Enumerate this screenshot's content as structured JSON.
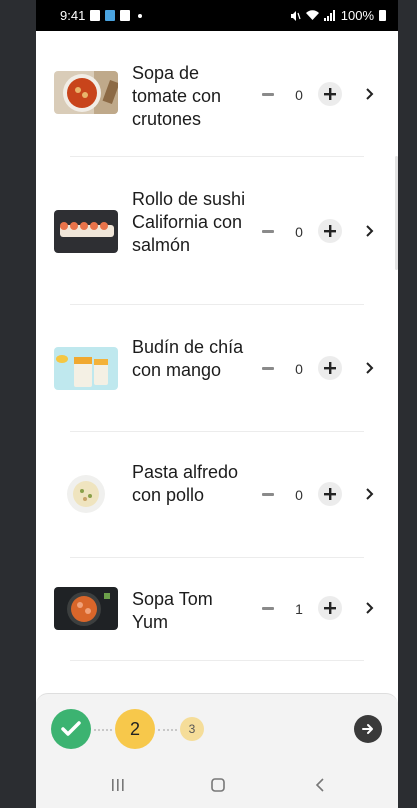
{
  "status_bar": {
    "time": "9:41",
    "battery": "100%"
  },
  "items": [
    {
      "name": "Sopa de tomate con crutones",
      "qty": "0"
    },
    {
      "name": "Rollo de sushi California con salmón",
      "qty": "0"
    },
    {
      "name": "Budín de chía con mango",
      "qty": "0"
    },
    {
      "name": "Pasta alfredo con pollo",
      "qty": "0"
    },
    {
      "name": "Sopa Tom Yum",
      "qty": "1"
    }
  ],
  "progress": {
    "step2_label": "2",
    "step3_label": "3"
  },
  "colors": {
    "done": "#3cb371",
    "active": "#f7c84b",
    "upcoming": "#f5dd99"
  }
}
